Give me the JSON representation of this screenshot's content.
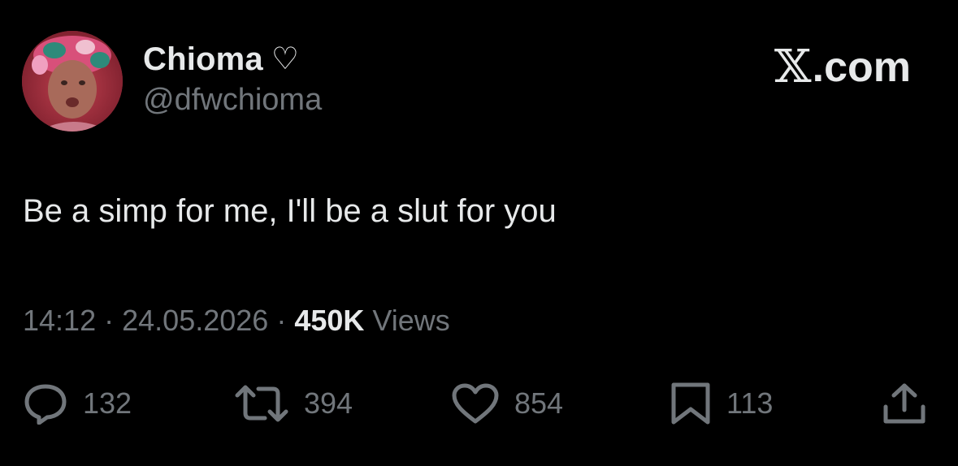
{
  "tweet": {
    "author": {
      "display_name": "Chioma",
      "name_emoji": "♡",
      "handle": "@dfwchioma",
      "avatar": "avatar-photo"
    },
    "brand": {
      "logo": "x-logo",
      "domain": ".com"
    },
    "text": "Be a simp for me, I'll be a slut for you",
    "meta": {
      "time": "14:12",
      "separator": "·",
      "date": "24.05.2026",
      "views_count": "450K",
      "views_label": "Views"
    },
    "actions": {
      "replies": "132",
      "reposts": "394",
      "likes": "854",
      "bookmarks": "113"
    }
  },
  "colors": {
    "background": "#000000",
    "primary_text": "#e7e9ea",
    "secondary_text": "#71767b"
  }
}
